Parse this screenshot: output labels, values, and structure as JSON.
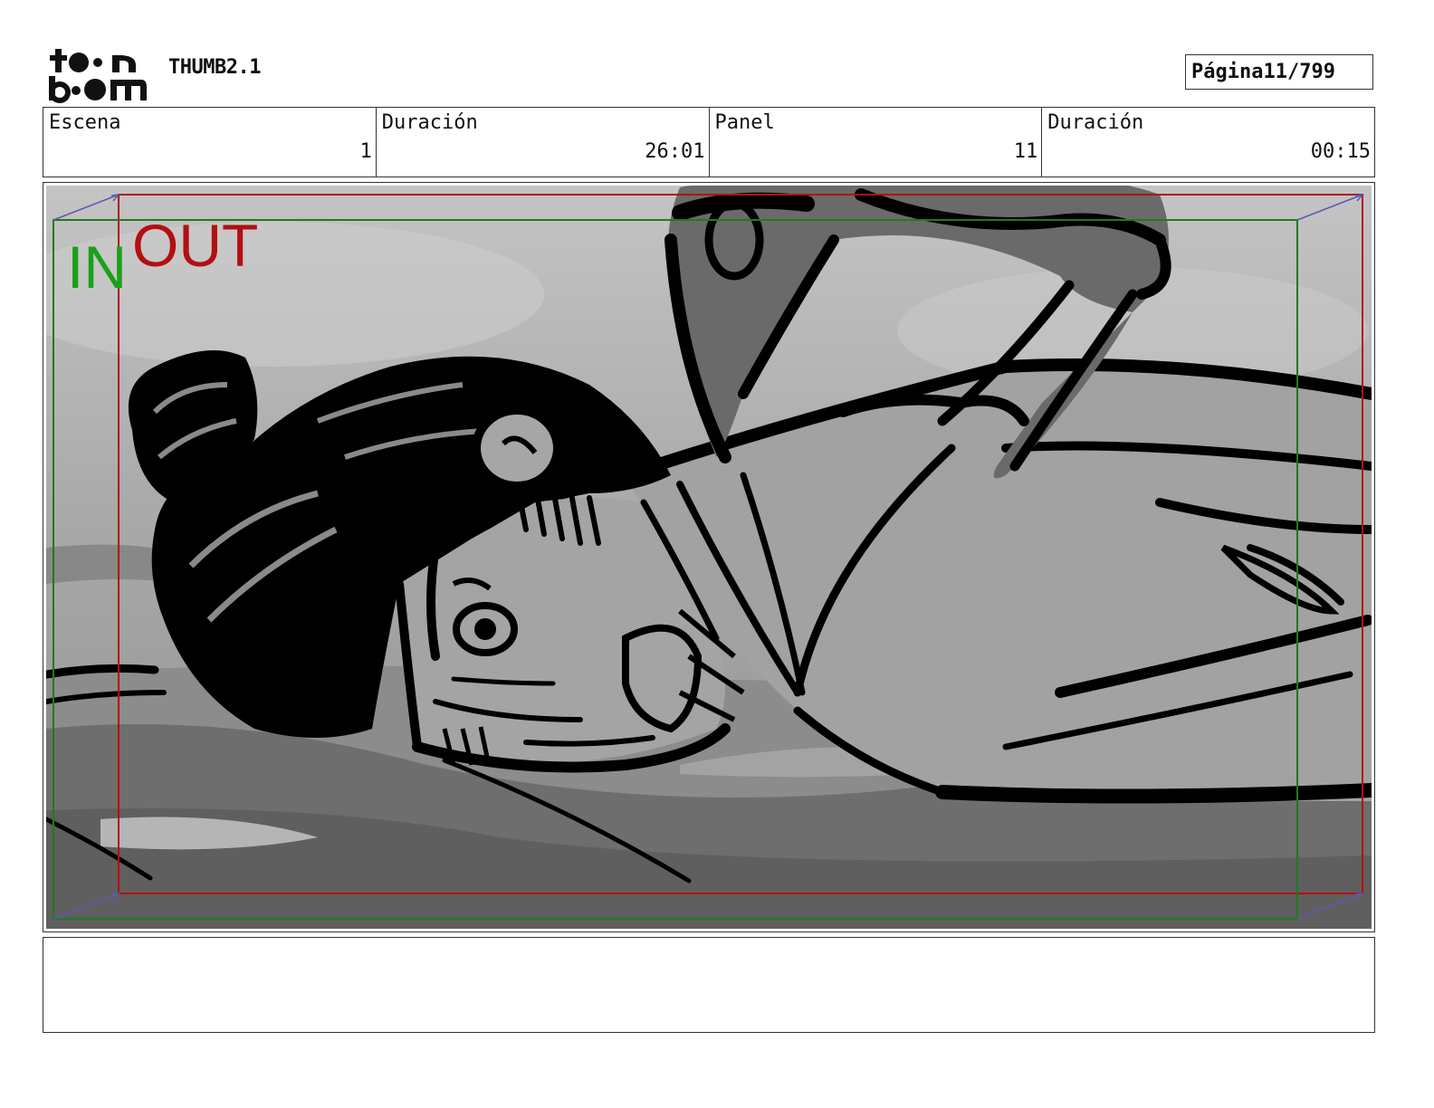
{
  "header": {
    "logo": {
      "text": "toon boom",
      "icon": "toon-boom-logo-icon"
    },
    "doc_title": "THUMB2.1",
    "page_label": "Página",
    "page_value": "11/799"
  },
  "info": [
    {
      "label": "Escena",
      "value": "1"
    },
    {
      "label": "Duración",
      "value": "26:01"
    },
    {
      "label": "Panel",
      "value": "11"
    },
    {
      "label": "Duración",
      "value": "00:15"
    }
  ],
  "panel": {
    "in_label": "IN",
    "out_label": "OUT",
    "colors": {
      "in_frame": "#1f7a1f",
      "out_frame": "#b31010",
      "in_text": "#1aa01a",
      "out_text": "#b31010",
      "camera_arrow": "#5a5ab0"
    }
  },
  "notes": {
    "text": ""
  }
}
